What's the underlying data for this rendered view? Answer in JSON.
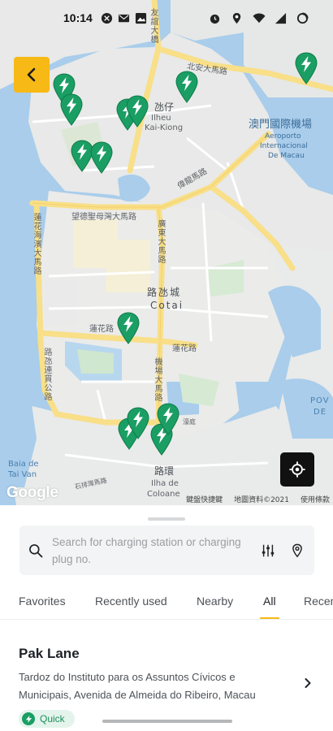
{
  "status_bar": {
    "time": "10:14"
  },
  "map": {
    "labels": {
      "taipa_cn": "氹仔",
      "taipa_pt1": "Ilheu",
      "taipa_pt2": "Kai-Kiong",
      "cotai_cn": "路氹城",
      "cotai_pt": "Cotai",
      "coloane_cn": "路環",
      "coloane_pt1": "Ilha de",
      "coloane_pt2": "Coloane",
      "airport_cn": "澳門國際機場",
      "airport_pt1": "Aeroporto",
      "airport_pt2": "Internacional",
      "airport_pt3": "De Macau",
      "bay_1": "Baia de",
      "bay_2": "Tai Van",
      "pov_1": "POV",
      "pov_2": "DE",
      "road_north": "北安大馬路",
      "road_main": "望德聖母灣大馬路",
      "road_lotus": "蓮花路",
      "road_lotus2": "蓮花路",
      "road_airport": "偉龍馬路",
      "road_guangdong": "廣東大馬路",
      "road_lotus_west": "蓮花海濱大馬路",
      "road_east1": "機場大馬路",
      "road_coloane": "石排灣馬路",
      "road_estrada": "路氹連貫公路",
      "road_airport_n": "友誼大橋",
      "road_sw": "濠庭"
    },
    "google_logo": "Google",
    "attribution": [
      "鍵盤快捷鍵",
      "地圖資料©2021",
      "使用條款"
    ]
  },
  "search": {
    "placeholder": "Search for charging station or charging plug no."
  },
  "tabs": [
    "Favorites",
    "Recently used",
    "Nearby",
    "All",
    "Recen"
  ],
  "active_tab": "All",
  "station": {
    "name": "Pak Lane",
    "address": "Tardoz do Instituto para os Assuntos Cívicos e Municipais, Avenida de Almeida do Ribeiro, Macau",
    "tag": "Quick"
  },
  "colors": {
    "accent": "#F7B916",
    "pin_green": "#1A9E64",
    "water": "#A9CDEB",
    "road_major": "#F8DF88"
  },
  "icons": {
    "back": "chevron-left-icon",
    "locate": "crosshair-icon",
    "search": "search-icon",
    "filter": "filter-sliders-icon",
    "location": "map-pin-icon",
    "next": "chevron-right-icon"
  }
}
